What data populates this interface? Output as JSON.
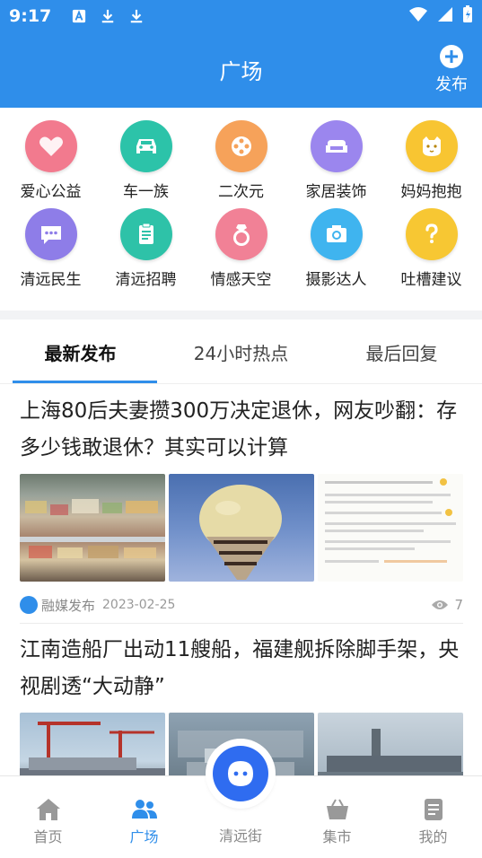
{
  "status_bar": {
    "time": "9:17"
  },
  "header": {
    "title": "广场",
    "publish_label": "发布"
  },
  "categories": [
    {
      "label": "爱心公益",
      "icon": "heart-icon",
      "color": "#f27a8e"
    },
    {
      "label": "车一族",
      "icon": "car-icon",
      "color": "#2cc3a9"
    },
    {
      "label": "二次元",
      "icon": "film-reel-icon",
      "color": "#f6a25a"
    },
    {
      "label": "家居装饰",
      "icon": "sofa-icon",
      "color": "#9b86ee"
    },
    {
      "label": "妈妈抱抱",
      "icon": "cat-icon",
      "color": "#f8c532"
    },
    {
      "label": "清远民生",
      "icon": "chat-icon",
      "color": "#8e7de8"
    },
    {
      "label": "清远招聘",
      "icon": "clipboard-icon",
      "color": "#2ec2a8"
    },
    {
      "label": "情感天空",
      "icon": "ring-icon",
      "color": "#f18196"
    },
    {
      "label": "摄影达人",
      "icon": "camera-icon",
      "color": "#3fb4ef"
    },
    {
      "label": "吐槽建议",
      "icon": "question-icon",
      "color": "#f7c733"
    }
  ],
  "tabs": [
    {
      "label": "最新发布",
      "active": true
    },
    {
      "label": "24小时热点",
      "active": false
    },
    {
      "label": "最后回复",
      "active": false
    }
  ],
  "posts": [
    {
      "title": "上海80后夫妻攒300万决定退休，网友吵翻：存多少钱敢退休？其实可以计算",
      "source": "融媒发布",
      "date": "2023-02-25",
      "views": "7"
    },
    {
      "title": "江南造船厂出动11艘船，福建舰拆除脚手架，央视剧透“大动静”"
    }
  ],
  "bottom_nav": [
    {
      "label": "首页",
      "icon": "home-icon",
      "active": false
    },
    {
      "label": "广场",
      "icon": "people-icon",
      "active": true
    },
    {
      "label": "清远街",
      "icon": "mascot-icon",
      "active": false
    },
    {
      "label": "集市",
      "icon": "basket-icon",
      "active": false
    },
    {
      "label": "我的",
      "icon": "profile-icon",
      "active": false
    }
  ],
  "colors": {
    "brand": "#2f8eea"
  }
}
